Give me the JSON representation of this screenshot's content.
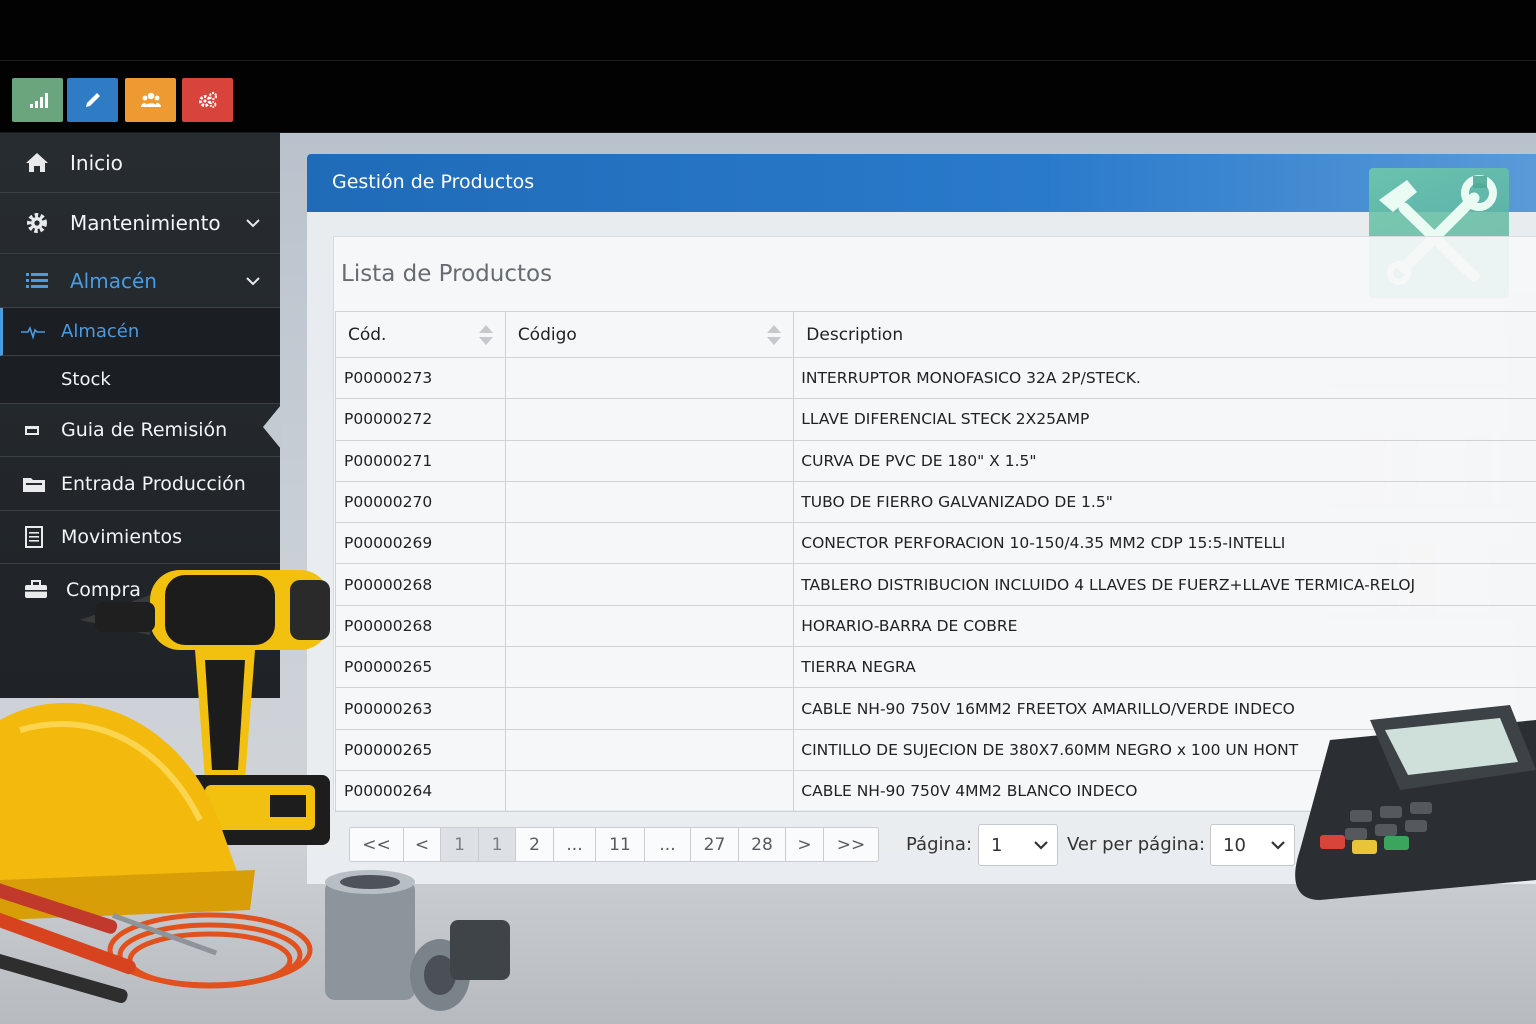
{
  "toolbar": {
    "buttons": [
      {
        "name": "stats",
        "icon": "bar-chart-icon",
        "color": "#6aa57d"
      },
      {
        "name": "edit",
        "icon": "pencil-icon",
        "color": "#2f7bc4"
      },
      {
        "name": "users",
        "icon": "users-icon",
        "color": "#ee9a33"
      },
      {
        "name": "settings",
        "icon": "cogs-icon",
        "color": "#d8433b"
      }
    ]
  },
  "sidebar": {
    "items": [
      {
        "label": "Inicio",
        "icon": "home-icon"
      },
      {
        "label": "Mantenimiento",
        "icon": "gear-icon"
      },
      {
        "label": "Almacén",
        "icon": "list-icon",
        "color": "#4a9be0"
      },
      {
        "label": "Almacén",
        "icon": "pulse-icon",
        "color": "#4a9be0"
      },
      {
        "label": "Stock"
      },
      {
        "label": "Guia de Remisión",
        "icon": "card-icon"
      },
      {
        "label": "Entrada Producción",
        "icon": "folder-icon"
      },
      {
        "label": "Movimientos",
        "icon": "document-icon"
      },
      {
        "label": "Compra",
        "icon": "briefcase-icon"
      }
    ]
  },
  "panel": {
    "title": "Gestión de Productos",
    "list_title": "Lista de Productos"
  },
  "table": {
    "headers": [
      "Cód.",
      "Código",
      "Description"
    ],
    "rows": [
      {
        "cod": "P00000273",
        "codigo": "",
        "description": "INTERRUPTOR MONOFASICO 32A 2P/STECK."
      },
      {
        "cod": "P00000272",
        "codigo": "",
        "description": "LLAVE DIFERENCIAL STECK 2X25AMP"
      },
      {
        "cod": "P00000271",
        "codigo": "",
        "description": "CURVA DE PVC DE 180\" X 1.5\""
      },
      {
        "cod": "P00000270",
        "codigo": "",
        "description": "TUBO DE FIERRO GALVANIZADO DE 1.5\""
      },
      {
        "cod": "P00000269",
        "codigo": "",
        "description": "CONECTOR PERFORACION 10-150/4.35 MM2 CDP 15:5-INTELLI"
      },
      {
        "cod": "P00000268",
        "codigo": "",
        "description": "TABLERO DISTRIBUCION INCLUIDO 4 LLAVES DE FUERZ+LLAVE TERMICA-RELOJ"
      },
      {
        "cod": "P00000268",
        "codigo": "",
        "description": "HORARIO-BARRA DE COBRE"
      },
      {
        "cod": "P00000265",
        "codigo": "",
        "description": "TIERRA NEGRA"
      },
      {
        "cod": "P00000263",
        "codigo": "",
        "description": "CABLE NH-90 750V 16MM2 FREETOX AMARILLO/VERDE INDECO"
      },
      {
        "cod": "P00000265",
        "codigo": "",
        "description": "CINTILLO DE SUJECION DE 380X7.60MM NEGRO x 100 UN HONT"
      },
      {
        "cod": "P00000264",
        "codigo": "",
        "description": "CABLE NH-90 750V 4MM2 BLANCO INDECO"
      }
    ]
  },
  "pagination": {
    "pages": [
      "<<",
      "<",
      "1",
      "1",
      "2",
      "...",
      "11",
      "...",
      "27",
      "28",
      ">",
      ">>"
    ],
    "pagina_label": "Página:",
    "pagina_value": "1",
    "per_page_label": "Ver per página:",
    "per_page_value": "10"
  }
}
